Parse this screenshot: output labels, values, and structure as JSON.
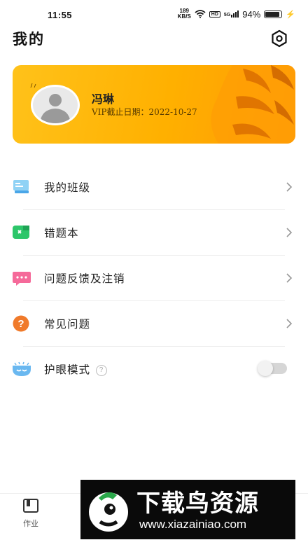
{
  "status_bar": {
    "time": "11:55",
    "net_speed_value": "189",
    "net_speed_unit": "KB/S",
    "hd": "HD",
    "sim": "5G",
    "battery_percent": "94%",
    "battery_level": 0.94
  },
  "header": {
    "title": "我的",
    "settings_icon": "settings-icon"
  },
  "profile": {
    "name": "冯琳",
    "vip_label": "VIP截止日期：",
    "vip_date": "2022-10-27",
    "card_color": "#ffb400"
  },
  "menu": [
    {
      "label": "我的班级",
      "icon": "class-icon"
    },
    {
      "label": "错题本",
      "icon": "notebook-icon"
    },
    {
      "label": "问题反馈及注销",
      "icon": "feedback-icon"
    },
    {
      "label": "常见问题",
      "icon": "faq-icon"
    }
  ],
  "eye_mode": {
    "label": "护眼模式",
    "help": "?",
    "enabled": false
  },
  "tabbar": {
    "tabs": [
      {
        "label": "作业",
        "icon": "homework-icon"
      }
    ]
  },
  "watermark": {
    "title": "下载鸟资源",
    "url": "www.xiazainiao.com"
  }
}
